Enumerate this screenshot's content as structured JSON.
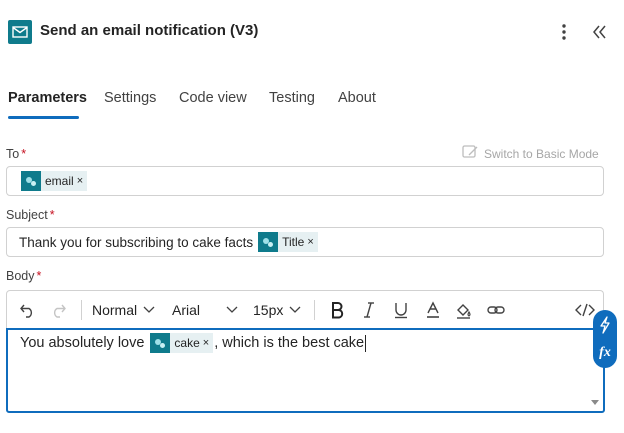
{
  "header": {
    "title": "Send an email notification (V3)",
    "icon": "mail-icon"
  },
  "tabs": [
    {
      "label": "Parameters",
      "active": true
    },
    {
      "label": "Settings"
    },
    {
      "label": "Code view"
    },
    {
      "label": "Testing"
    },
    {
      "label": "About"
    }
  ],
  "switch_basic_mode": "Switch to Basic Mode",
  "fields": {
    "to": {
      "label": "To",
      "required": "*",
      "tokens": [
        {
          "label": "email",
          "remove": "×"
        }
      ]
    },
    "subject": {
      "label": "Subject",
      "required": "*",
      "text": "Thank you for subscribing to cake facts",
      "tokens": [
        {
          "label": "Title",
          "remove": "×"
        }
      ]
    },
    "body": {
      "label": "Body",
      "required": "*",
      "text_before": "You absolutely love",
      "token": {
        "label": "cake",
        "remove": "×"
      },
      "text_after": ", which is the best cake"
    }
  },
  "toolbar": {
    "block_style": "Normal",
    "font": "Arial",
    "size": "15px"
  },
  "colors": {
    "accent": "#0f6cbd",
    "token_icon": "#0f7b8c",
    "token_bg": "#e6f0f2",
    "required": "#c50f1f"
  }
}
